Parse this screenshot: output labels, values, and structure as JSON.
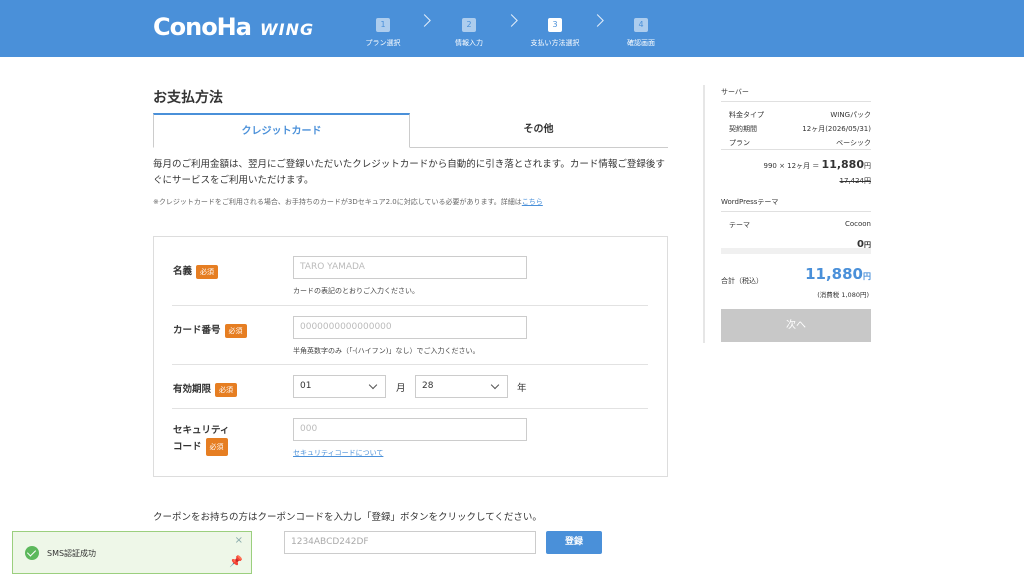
{
  "header": {
    "logo_main": "ConoHa",
    "logo_sub": "WING",
    "steps": [
      {
        "num": "1",
        "label": "プラン選択"
      },
      {
        "num": "2",
        "label": "情報入力"
      },
      {
        "num": "3",
        "label": "支払い方法選択"
      },
      {
        "num": "4",
        "label": "確認画面"
      }
    ],
    "active_step": 3,
    "color": "#4a90d9"
  },
  "main": {
    "title": "お支払方法",
    "tabs": [
      {
        "label": "クレジットカード",
        "active": true
      },
      {
        "label": "その他",
        "active": false
      }
    ],
    "description": "毎月のご利用金額は、翌月にご登録いただいたクレジットカードから自動的に引き落とされます。カード情報ご登録後すぐにサービスをご利用いただけます。",
    "note_text": "※クレジットカードをご利用される場合、お手持ちのカードが3Dセキュア2.0に対応している必要があります。詳細は",
    "note_link": "こちら"
  },
  "form": {
    "required_badge": "必須",
    "name": {
      "label": "名義",
      "placeholder": "TARO YAMADA",
      "help": "カードの表記のとおりご入力ください。"
    },
    "card_number": {
      "label": "カード番号",
      "placeholder": "0000000000000000",
      "help": "半角英数字のみ（「-(ハイフン)」なし）でご入力ください。"
    },
    "expiry": {
      "label": "有効期限",
      "month_value": "01",
      "month_unit": "月",
      "year_value": "28",
      "year_unit": "年"
    },
    "security": {
      "label_line1": "セキュリティ",
      "label_line2": "コード",
      "placeholder": "000",
      "link": "セキュリティコードについて"
    }
  },
  "coupon": {
    "text": "クーポンをお持ちの方はクーポンコードを入力し「登録」ボタンをクリックしてください。",
    "placeholder": "1234ABCD242DF",
    "button": "登録"
  },
  "toast": {
    "text": "SMS認証成功",
    "close": "×",
    "pin": "📌"
  },
  "sidebar": {
    "server_heading": "サーバー",
    "rows": [
      {
        "key": "料金タイプ",
        "value": "WINGパック"
      },
      {
        "key": "契約期間",
        "value": "12ヶ月(2026/05/31)"
      },
      {
        "key": "プラン",
        "value": "ベーシック"
      }
    ],
    "price_formula": "990 × 12ヶ月 ＝",
    "price_amount": "11,880",
    "price_yen": "円",
    "price_original": "17,424円",
    "wp_heading": "WordPressテーマ",
    "theme_key": "テーマ",
    "theme_value": "Cocoon",
    "theme_price": "0",
    "theme_yen": "円",
    "total_label": "合計（税込）",
    "total_amount": "11,880",
    "total_yen": "円",
    "tax": "(消費税 1,080円)",
    "next_button": "次へ"
  }
}
